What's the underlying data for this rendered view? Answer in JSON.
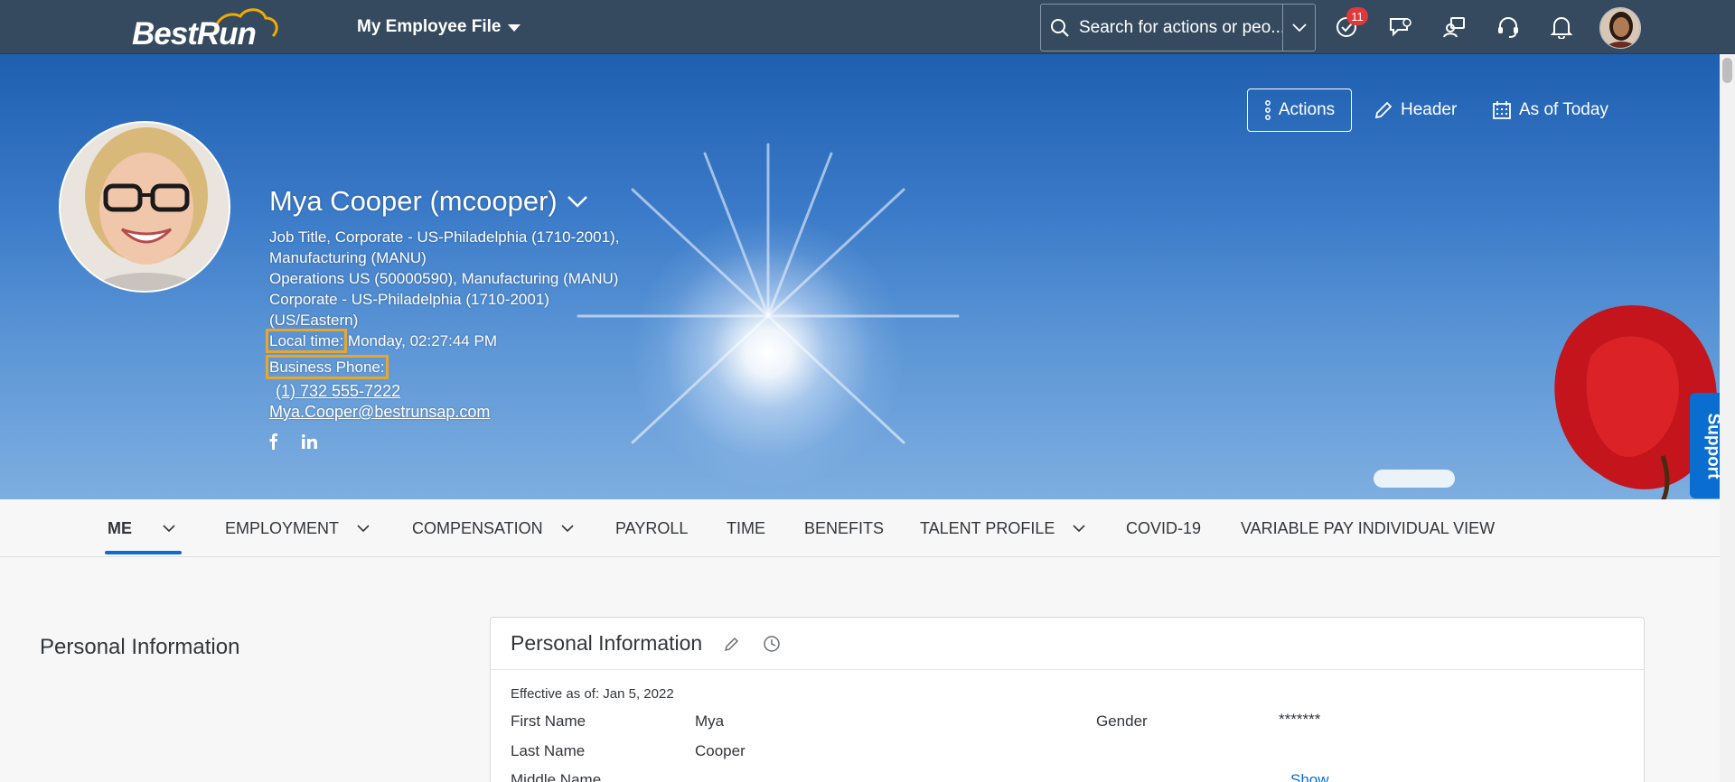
{
  "shell": {
    "logo_text": "BestRun",
    "menu_title": "My Employee File",
    "search_placeholder": "Search for actions or peo...",
    "notification_count": "11"
  },
  "header_actions": {
    "actions_label": "Actions",
    "header_label": "Header",
    "as_of_label": "As of Today"
  },
  "profile": {
    "name": "Mya Cooper (mcooper)",
    "job_line_1": "Job Title, Corporate - US-Philadelphia (1710-2001),",
    "job_line_2": "Manufacturing (MANU)",
    "job_line_3": "Operations US (50000590), Manufacturing (MANU)",
    "job_line_4": "Corporate - US-Philadelphia (1710-2001)",
    "job_line_5": "(US/Eastern)",
    "local_time_label": "Local time:",
    "local_time_value": " Monday, 02:27:44 PM",
    "business_phone_label": "Business Phone:",
    "phone": "(1) 732 555-7222",
    "email": "Mya.Cooper@bestrunsap.com"
  },
  "support_label": "Support",
  "tabs": [
    {
      "label": "ME"
    },
    {
      "label": "EMPLOYMENT"
    },
    {
      "label": "COMPENSATION"
    },
    {
      "label": "PAYROLL"
    },
    {
      "label": "TIME"
    },
    {
      "label": "BENEFITS"
    },
    {
      "label": "TALENT PROFILE"
    },
    {
      "label": "COVID-19"
    },
    {
      "label": "VARIABLE PAY INDIVIDUAL VIEW"
    }
  ],
  "content": {
    "side_title": "Personal Information",
    "card_title": "Personal Information",
    "effective": "Effective as of: Jan 5, 2022",
    "first_name_label": "First Name",
    "first_name_value": "Mya",
    "last_name_label": "Last Name",
    "last_name_value": "Cooper",
    "middle_name_label": "Middle Name",
    "gender_label": "Gender",
    "gender_value": "*******",
    "show_label": "Show"
  },
  "colors": {
    "shell": "#354a5f",
    "accent": "#0a6ed1",
    "highlight": "#e8a62a",
    "badge": "#e0383b"
  }
}
